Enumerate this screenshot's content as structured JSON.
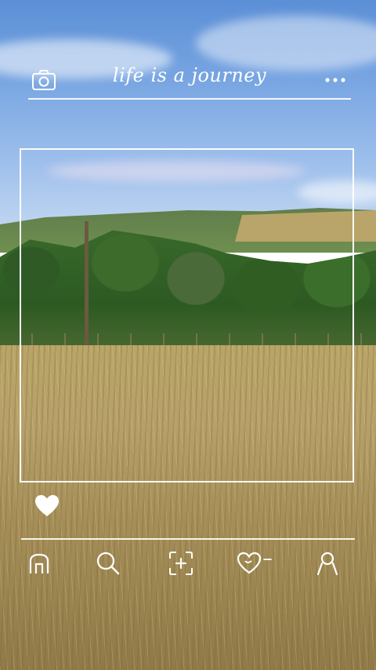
{
  "header": {
    "title": "life is a journey",
    "left_icon": "camera-icon",
    "right_icon": "more-options-icon"
  },
  "post": {
    "like_icon": "heart-icon"
  },
  "bottom_nav": {
    "items": [
      {
        "icon": "home-icon"
      },
      {
        "icon": "search-icon"
      },
      {
        "icon": "add-post-icon"
      },
      {
        "icon": "activity-heart-icon"
      },
      {
        "icon": "profile-icon"
      }
    ]
  },
  "colors": {
    "ui_line": "#ffffff",
    "sky": "#79a6e2",
    "grass": "#b7a06a"
  }
}
